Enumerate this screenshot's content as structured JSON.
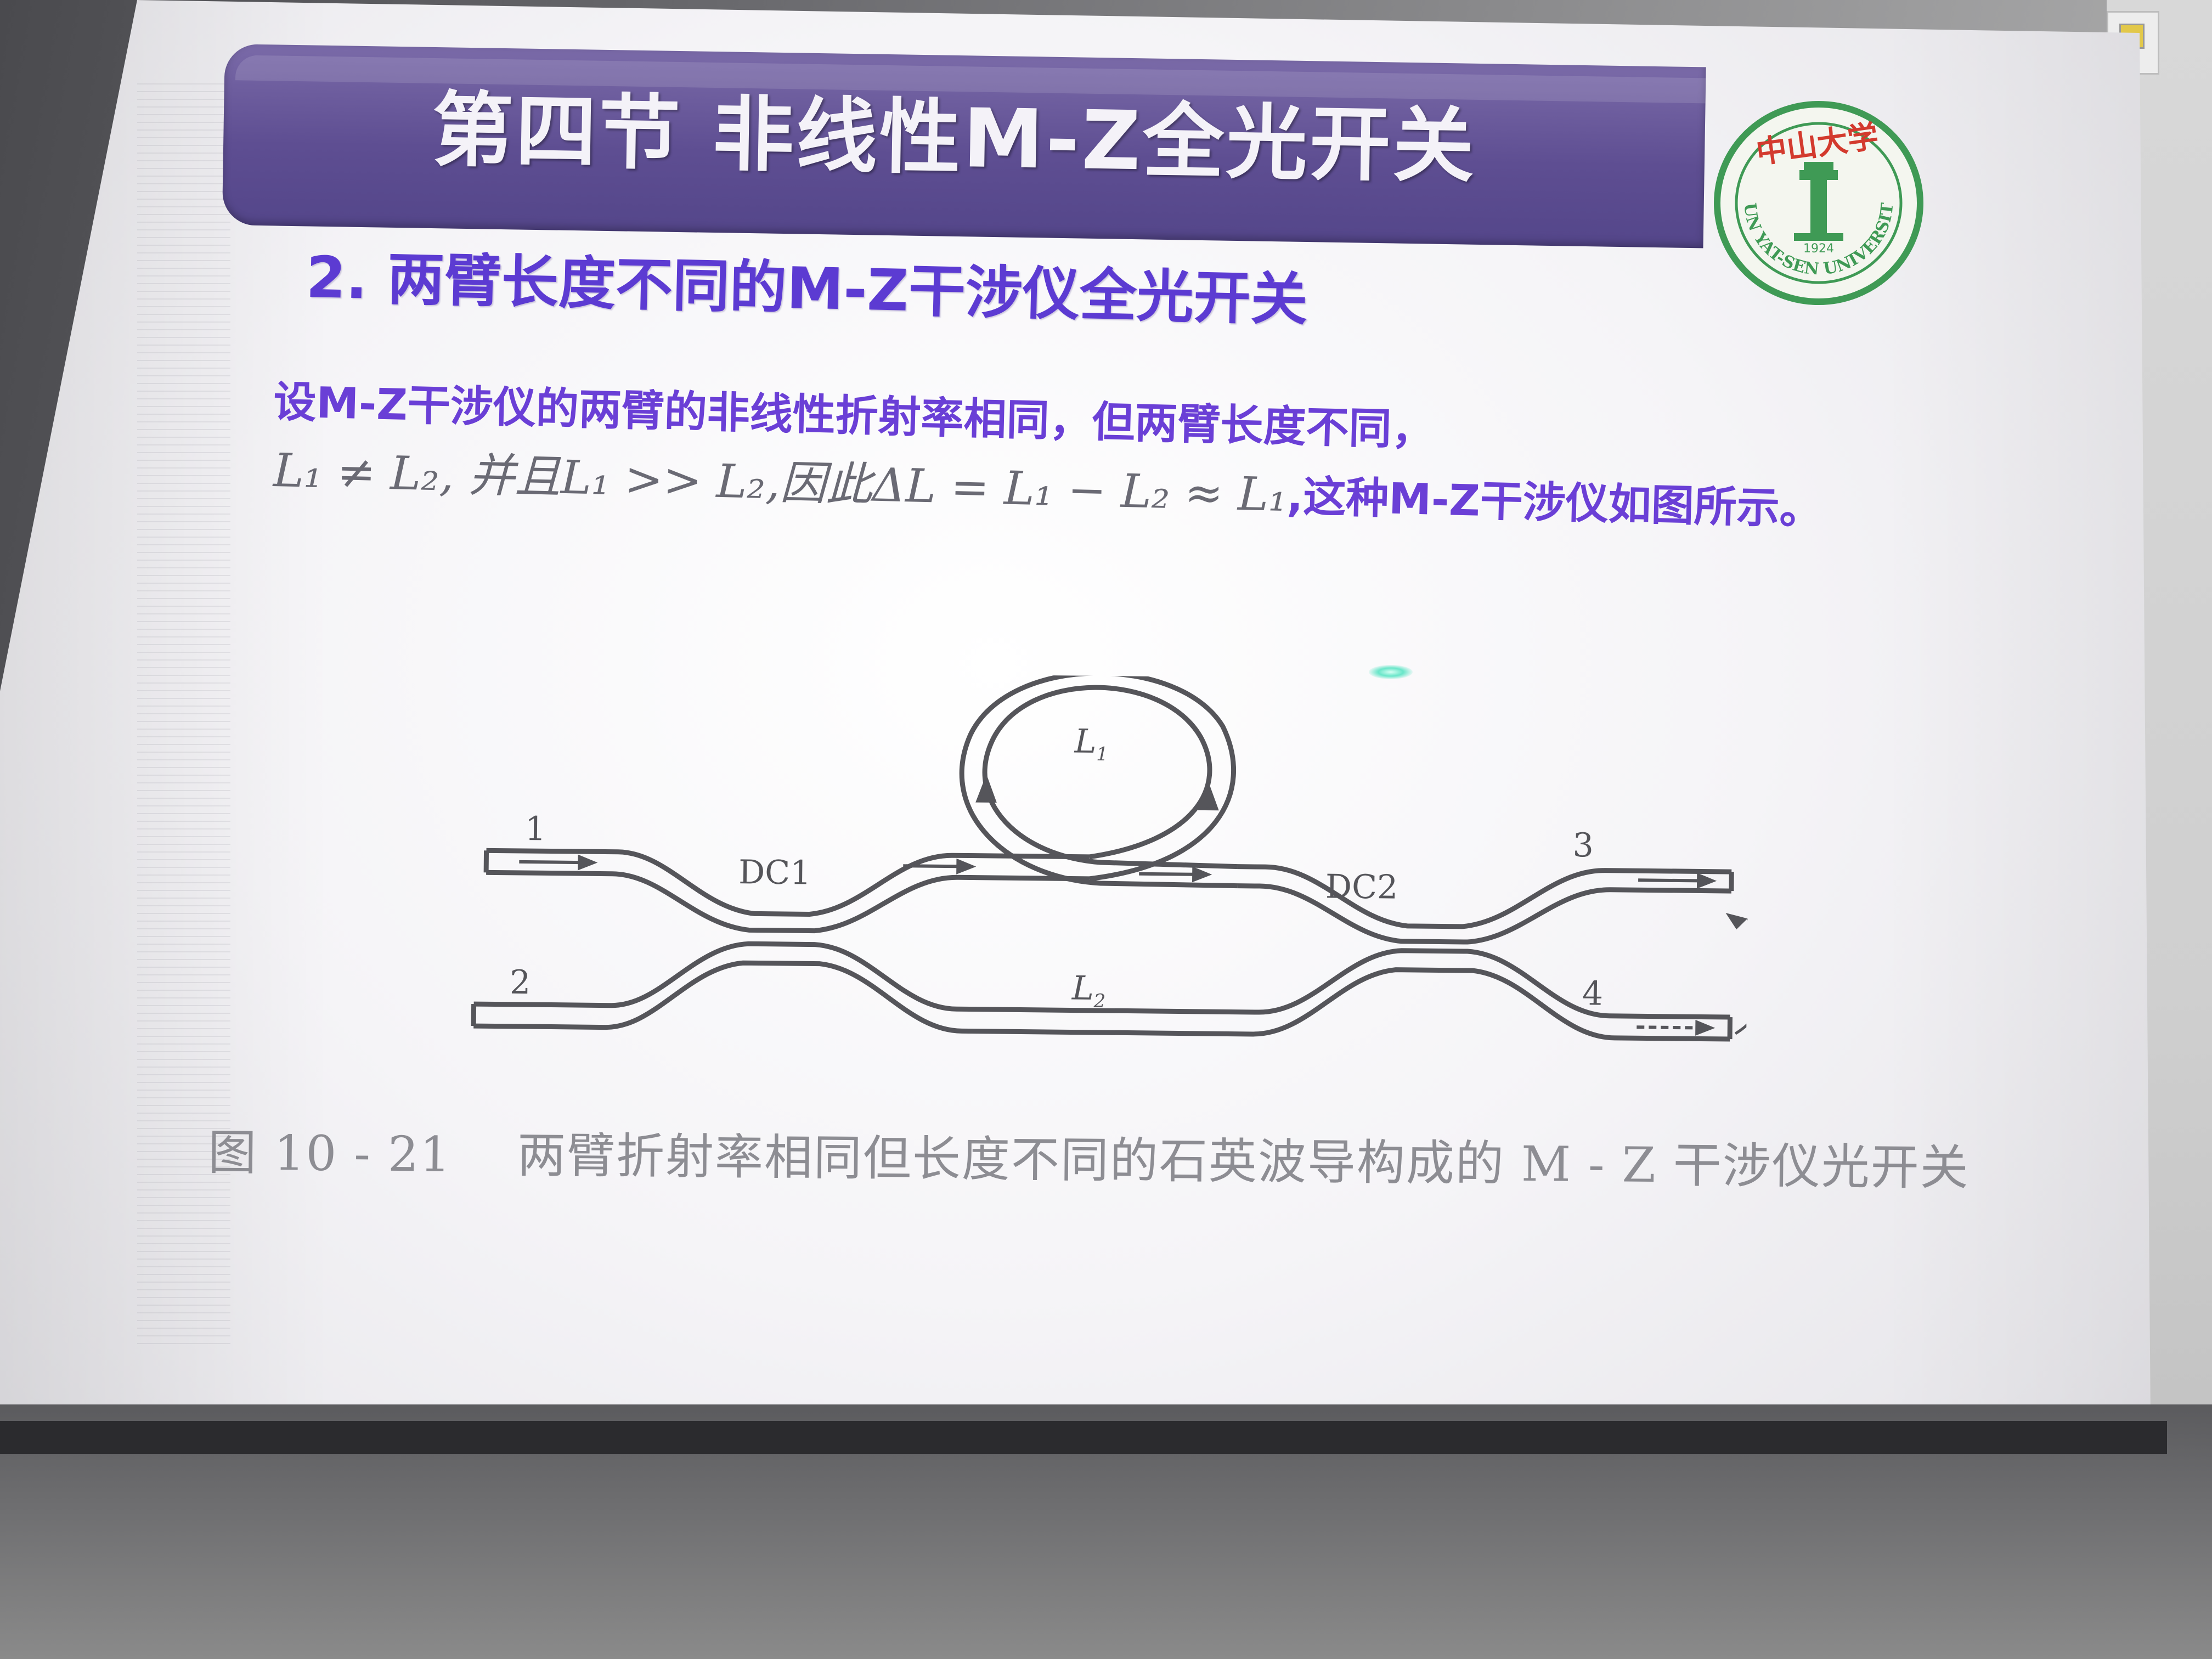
{
  "slide": {
    "title": "第四节 非线性M-Z全光开关",
    "subtitle": "2. 两臂长度不同的M-Z干涉仪全光开关",
    "line1": "设M-Z干涉仪的两臂的非线性折射率相同，但两臂长度不同，",
    "line2_formula": "L₁ ≠ L₂,  并且L₁ >> L₂,因此ΔL = L₁ − L₂ ≈ L₁",
    "line2_tail": ",这种M-Z干涉仪如图所示。",
    "caption_number": "图 10 - 21",
    "caption_text": "两臂折射率相同但长度不同的石英波导构成的 M - Z 干涉仪光开关"
  },
  "seal": {
    "top_text": "中山大学",
    "ring_text": "SUN YAT-SEN UNIVERSITY",
    "year": "1924",
    "color": "#3f9a55"
  },
  "diagram": {
    "port_1": "1",
    "port_2": "2",
    "port_3": "3",
    "port_4": "4",
    "coupler_1": "DC1",
    "coupler_2": "DC2",
    "arm_long": "L",
    "arm_long_sub": "1",
    "arm_short": "L",
    "arm_short_sub": "2"
  },
  "colors": {
    "banner": "#5e4e92",
    "subtitle": "#5c3bd2",
    "body_text": "#6a3fd6",
    "formula": "#6a6a74",
    "caption": "#8d8d93"
  }
}
